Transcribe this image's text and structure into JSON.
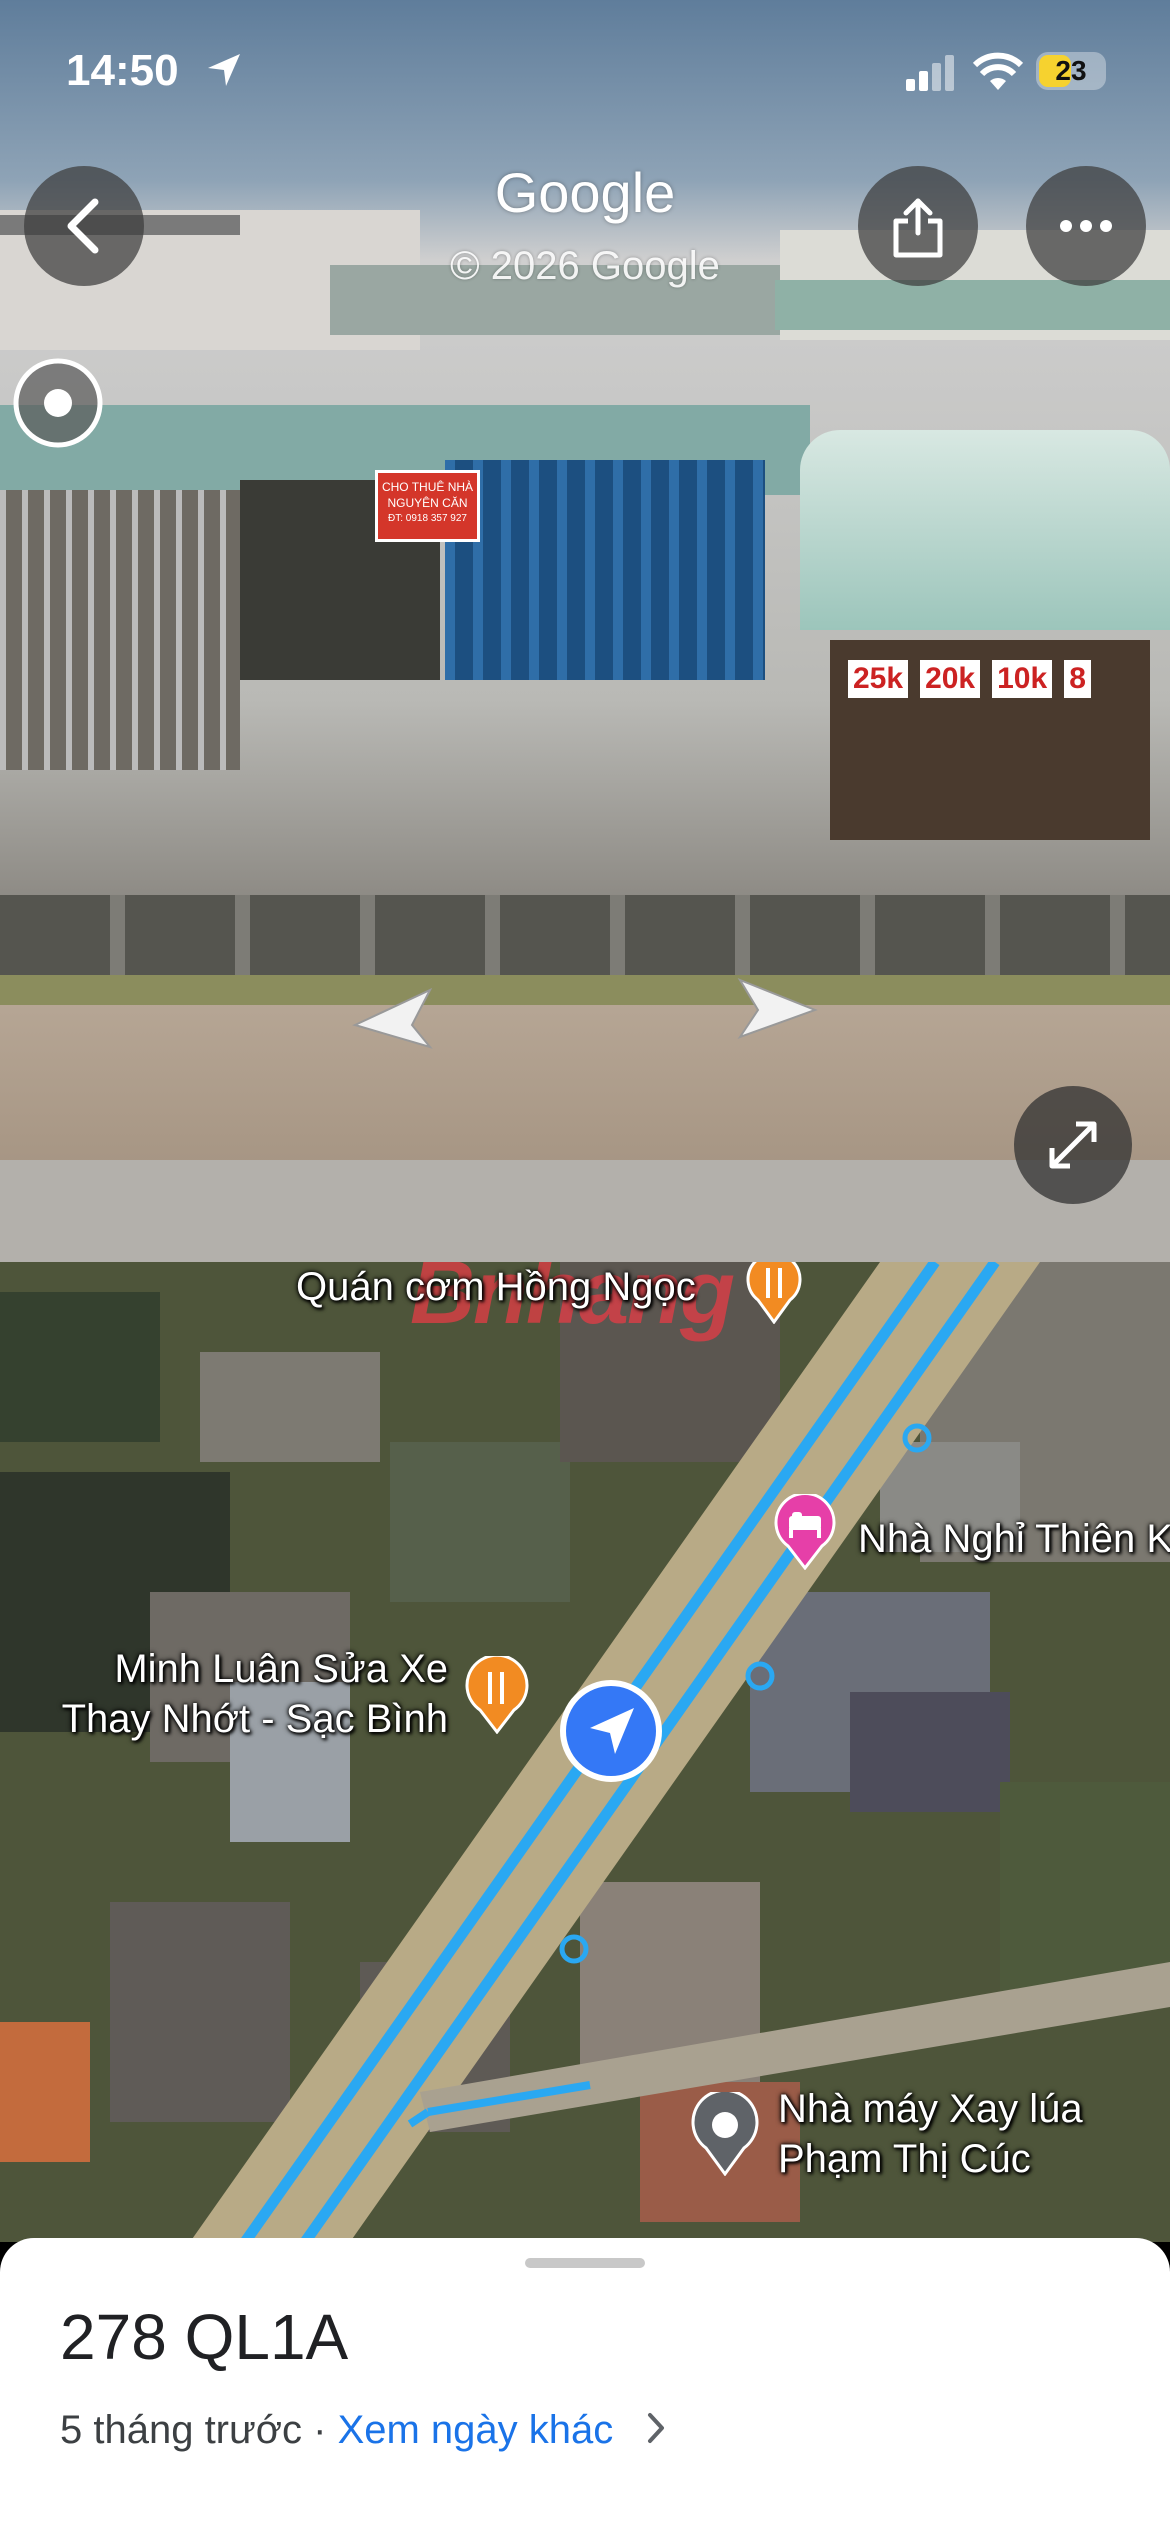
{
  "status_bar": {
    "time": "14:50",
    "battery": "23"
  },
  "header": {
    "brand": "Google",
    "copyright": "© 2026 Google"
  },
  "street_signs": {
    "rent_sign_line1": "CHO THUÊ NHÀ",
    "rent_sign_line2": "NGUYÊN CĂN",
    "rent_sign_phone": "ĐT: 0918 357 927",
    "prices": [
      "25k",
      "20k",
      "10k",
      "8"
    ]
  },
  "map": {
    "watermark": "Bnhang",
    "places": [
      {
        "name": "Quán cơm Hồng Ngọc",
        "icon": "restaurant-icon"
      },
      {
        "name": "Nhà Nghỉ Thiên K",
        "icon": "hotel-icon"
      },
      {
        "name_line1": "Minh Luân Sửa Xe",
        "name_line2": "Thay Nhớt - Sạc Bình",
        "icon": "restaurant-icon"
      },
      {
        "name_line1": "Nhà máy Xay lúa",
        "name_line2": "Phạm Thị Cúc",
        "icon": "place-pin-icon"
      }
    ]
  },
  "sheet": {
    "address": "278 QL1A",
    "date_text": "5 tháng trước",
    "separator": " · ",
    "other_dates_link": "Xem ngày khác"
  },
  "colors": {
    "link": "#1a73e8",
    "route": "#2aa8f2",
    "restaurant_pin": "#f28b22",
    "hotel_pin": "#e63fa8",
    "location_blue": "#3478f6"
  }
}
